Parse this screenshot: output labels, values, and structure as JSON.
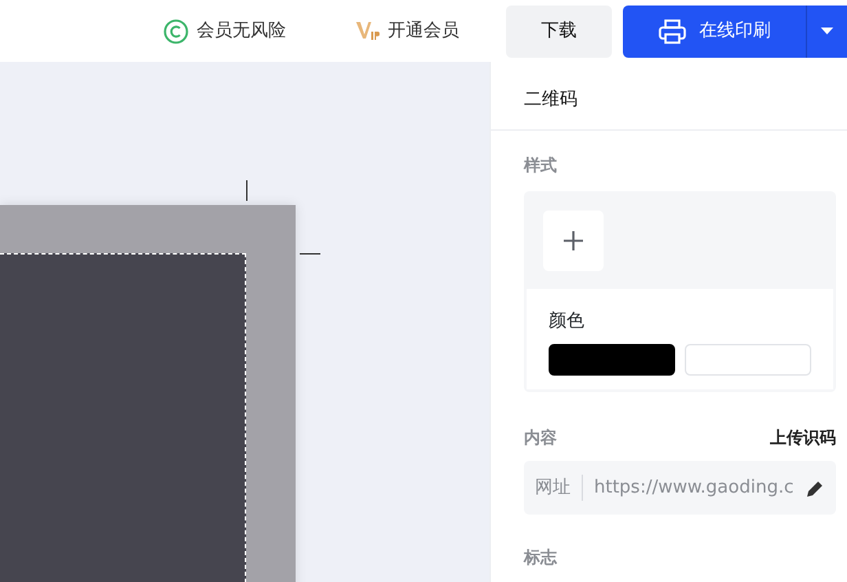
{
  "top_bar": {
    "links": [
      {
        "kind": "guarantee",
        "label": "会员无风险"
      },
      {
        "kind": "vip",
        "label": "开通会员"
      }
    ],
    "download_button": "下载",
    "print_button": "在线印刷"
  },
  "panel": {
    "title": "二维码",
    "style_section": {
      "label": "样式",
      "color_label": "颜色",
      "swatches": [
        {
          "color": "#000000"
        },
        {
          "color": "#ffffff"
        }
      ]
    },
    "content_section": {
      "label": "内容",
      "upload_link": "上传识码",
      "field_type": "网址",
      "field_value": "https://www.gaoding.c"
    },
    "logo_section": {
      "label": "标志"
    }
  }
}
